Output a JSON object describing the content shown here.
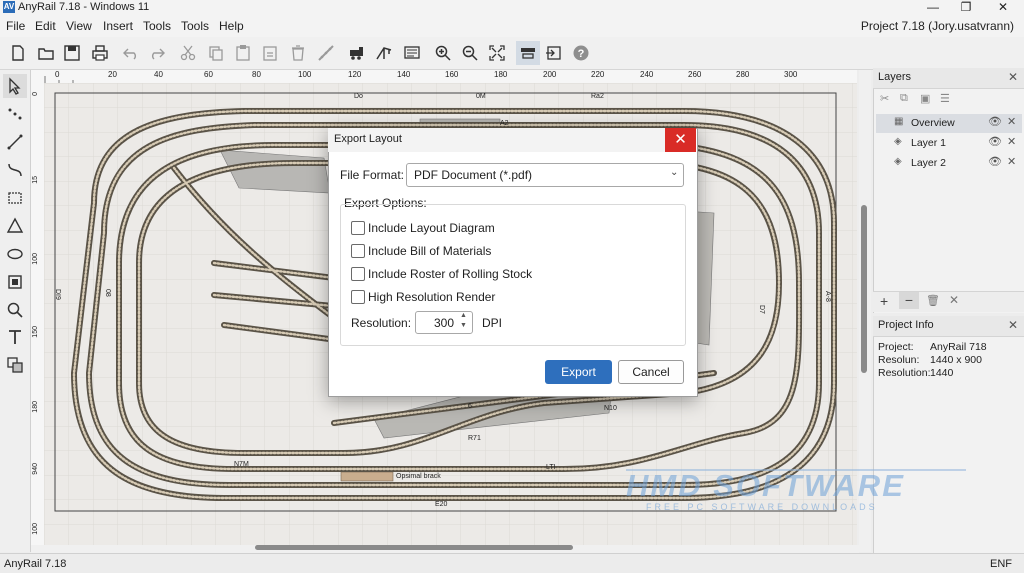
{
  "window": {
    "title": "AnyRail 7.18 - Windows 11",
    "app_icon_text": "AV"
  },
  "menu": {
    "items": [
      "File",
      "Edit",
      "View",
      "Insert",
      "Tools",
      "Tools",
      "Help"
    ],
    "project_label": "Project 7.18 (Jory.usatvrann)"
  },
  "toolbar_icons": [
    "new-file-icon",
    "open-folder-icon",
    "save-icon",
    "print-icon",
    "undo-icon",
    "redo-icon",
    "cut-icon",
    "copy-icon",
    "paste-icon",
    "paste-special-icon",
    "delete-icon",
    "flex-track-icon",
    "train-icon",
    "bill-of-materials-icon",
    "zoom-in-icon",
    "zoom-out-icon",
    "fit-screen-icon",
    "layout-export-icon",
    "import-icon",
    "help-icon"
  ],
  "tools": [
    "select-arrow-icon",
    "points-icon",
    "line-icon",
    "curve-icon",
    "rectangle-icon",
    "triangle-icon",
    "ellipse-icon",
    "frame-icon",
    "zoom-tool-icon",
    "text-tool-icon",
    "layers-tool-icon"
  ],
  "ruler": {
    "top_ticks": [
      "0",
      "20",
      "40",
      "60",
      "80",
      "100",
      "120",
      "140",
      "160",
      "180",
      "200",
      "220",
      "240",
      "260",
      "280",
      "300"
    ],
    "left_ticks": [
      "0",
      "15",
      "100",
      "150",
      "180",
      "940",
      "100"
    ]
  },
  "canvas_labels": {
    "top_left": "Do",
    "top_mid": "0M",
    "top_right": "Ra2",
    "platform": "A2",
    "left_a": "DI9",
    "left_b": "08",
    "right_a": "D7",
    "right_b": "A-8",
    "yard": "6",
    "n10": "N10",
    "r71": "R71",
    "n7m": "N7M",
    "lti": "LTI",
    "building": "Opsimal brack",
    "bottom": "E20"
  },
  "layers_panel": {
    "title": "Layers",
    "layers": [
      {
        "name": "Overview",
        "selected": true
      },
      {
        "name": "Layer 1",
        "selected": false
      },
      {
        "name": "Layer 2",
        "selected": false
      }
    ],
    "bottom_tools": [
      "+",
      "−",
      "🗑",
      "✕"
    ]
  },
  "project_info": {
    "title": "Project Info",
    "rows": [
      {
        "key": "Project:",
        "value": "AnyRail 718"
      },
      {
        "key": "Resolun:",
        "value": "1440 x 900"
      },
      {
        "key": "Resolution:",
        "value": "1440"
      }
    ]
  },
  "dialog": {
    "title": "Export Layout",
    "file_format_label": "File Format:",
    "file_format_value": "PDF Document (*.pdf)",
    "options_label": "Export Options:",
    "options": [
      {
        "label": "Include Layout Diagram",
        "checked": false
      },
      {
        "label": "Include Bill of Materials",
        "checked": false
      },
      {
        "label": "Include Roster of Rolling Stock",
        "checked": false
      },
      {
        "label": "High Resolution Render",
        "checked": false
      }
    ],
    "resolution_label": "Resolution:",
    "resolution_value": "300",
    "resolution_unit": "DPI",
    "export_label": "Export",
    "cancel_label": "Cancel"
  },
  "status": {
    "left": "AnyRail 7.18",
    "right": "ENF"
  },
  "watermark": {
    "main": "HMD SOFTWARE",
    "sub": "FREE PC SOFTWARE DOWNLOADS"
  },
  "colors": {
    "accent": "#2e6fbd",
    "close_red": "#d92b26",
    "track": "#5a5347",
    "canvas": "#eceae7"
  }
}
